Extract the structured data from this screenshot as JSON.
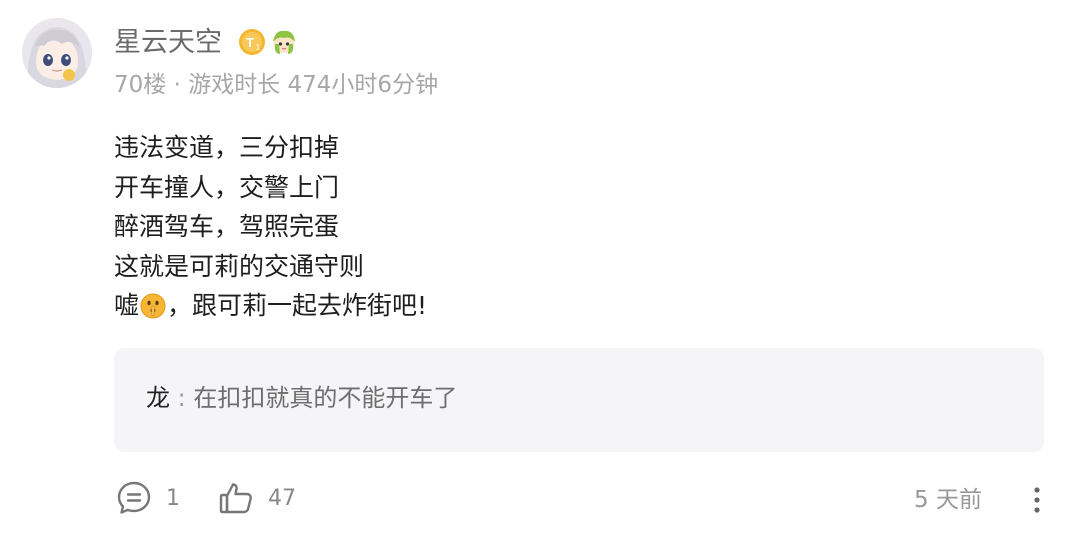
{
  "user": {
    "name": "星云天空",
    "floor": "70楼",
    "dot": "·",
    "playtime": "游戏时长 474小时6分钟",
    "level_badge_letter": "T",
    "level_badge_sub": "1"
  },
  "post": {
    "lines": [
      "违法变道，三分扣掉",
      "开车撞人，交警上门",
      "醉酒驾车，驾照完蛋",
      "这就是可莉的交通守则"
    ],
    "last_line_prefix": "嘘",
    "last_line_suffix": "，跟可莉一起去炸街吧!"
  },
  "reply": {
    "author": "龙",
    "separator": ":",
    "text": "在扣扣就真的不能开车了"
  },
  "actions": {
    "comment_count": "1",
    "like_count": "47",
    "time": "5 天前"
  },
  "icons": {
    "avatar": "anime-girl-avatar",
    "level_badge": "level-badge-icon",
    "fan_badge": "character-fan-badge-icon",
    "emoji": "shushing-face-emoji",
    "comment": "comment-bubble-icon",
    "like": "thumbs-up-icon",
    "more": "more-vertical-icon"
  },
  "colors": {
    "badge_gold": "#f4b631",
    "reply_bg": "#f5f5f7",
    "meta_gray": "#a7a7a7"
  }
}
